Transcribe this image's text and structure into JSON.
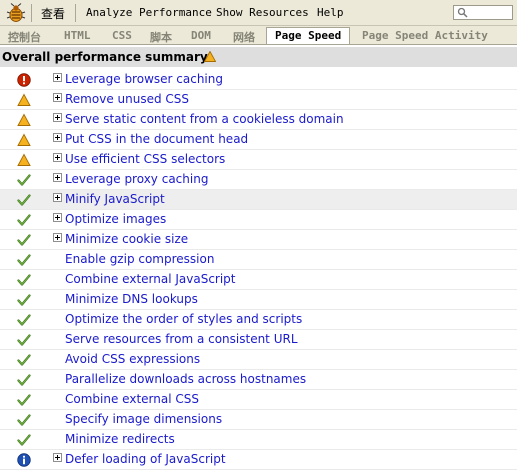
{
  "menu": {
    "view": "查看",
    "analyze": "Analyze Performance",
    "show_resources": "Show Resources",
    "help": "Help"
  },
  "tabs": [
    {
      "label": "控制台",
      "active": false
    },
    {
      "label": "HTML",
      "active": false
    },
    {
      "label": "CSS",
      "active": false
    },
    {
      "label": "脚本",
      "active": false
    },
    {
      "label": "DOM",
      "active": false
    },
    {
      "label": "网络",
      "active": false
    },
    {
      "label": "Page Speed",
      "active": true
    },
    {
      "label": "Page Speed Activity",
      "active": false
    }
  ],
  "summary": {
    "label": "Overall performance summary:",
    "status": "warning"
  },
  "rules": [
    {
      "label": "Leverage browser caching",
      "status": "error",
      "expandable": true
    },
    {
      "label": "Remove unused CSS",
      "status": "warning",
      "expandable": true
    },
    {
      "label": "Serve static content from a cookieless domain",
      "status": "warning",
      "expandable": true
    },
    {
      "label": "Put CSS in the document head",
      "status": "warning",
      "expandable": true
    },
    {
      "label": "Use efficient CSS selectors",
      "status": "warning",
      "expandable": true
    },
    {
      "label": "Leverage proxy caching",
      "status": "pass",
      "expandable": true
    },
    {
      "label": "Minify JavaScript",
      "status": "pass",
      "expandable": true,
      "highlighted": true
    },
    {
      "label": "Optimize images",
      "status": "pass",
      "expandable": true
    },
    {
      "label": "Minimize cookie size",
      "status": "pass",
      "expandable": true
    },
    {
      "label": "Enable gzip compression",
      "status": "pass",
      "expandable": false
    },
    {
      "label": "Combine external JavaScript",
      "status": "pass",
      "expandable": false
    },
    {
      "label": "Minimize DNS lookups",
      "status": "pass",
      "expandable": false
    },
    {
      "label": "Optimize the order of styles and scripts",
      "status": "pass",
      "expandable": false
    },
    {
      "label": "Serve resources from a consistent URL",
      "status": "pass",
      "expandable": false
    },
    {
      "label": "Avoid CSS expressions",
      "status": "pass",
      "expandable": false
    },
    {
      "label": "Parallelize downloads across hostnames",
      "status": "pass",
      "expandable": false
    },
    {
      "label": "Combine external CSS",
      "status": "pass",
      "expandable": false
    },
    {
      "label": "Specify image dimensions",
      "status": "pass",
      "expandable": false
    },
    {
      "label": "Minimize redirects",
      "status": "pass",
      "expandable": false
    },
    {
      "label": "Defer loading of JavaScript",
      "status": "info",
      "expandable": true
    }
  ],
  "colors": {
    "link": "#1a1acc",
    "error": "#cc2200",
    "warning": "#f0a000",
    "pass": "#3f7a1e",
    "info": "#1f50b4"
  },
  "icons": {
    "app": "firebug-icon",
    "search": "search-icon",
    "error": "error-icon",
    "warning": "warning-icon",
    "pass": "checkmark-icon",
    "info": "info-icon",
    "expand": "expand-plus-icon"
  }
}
